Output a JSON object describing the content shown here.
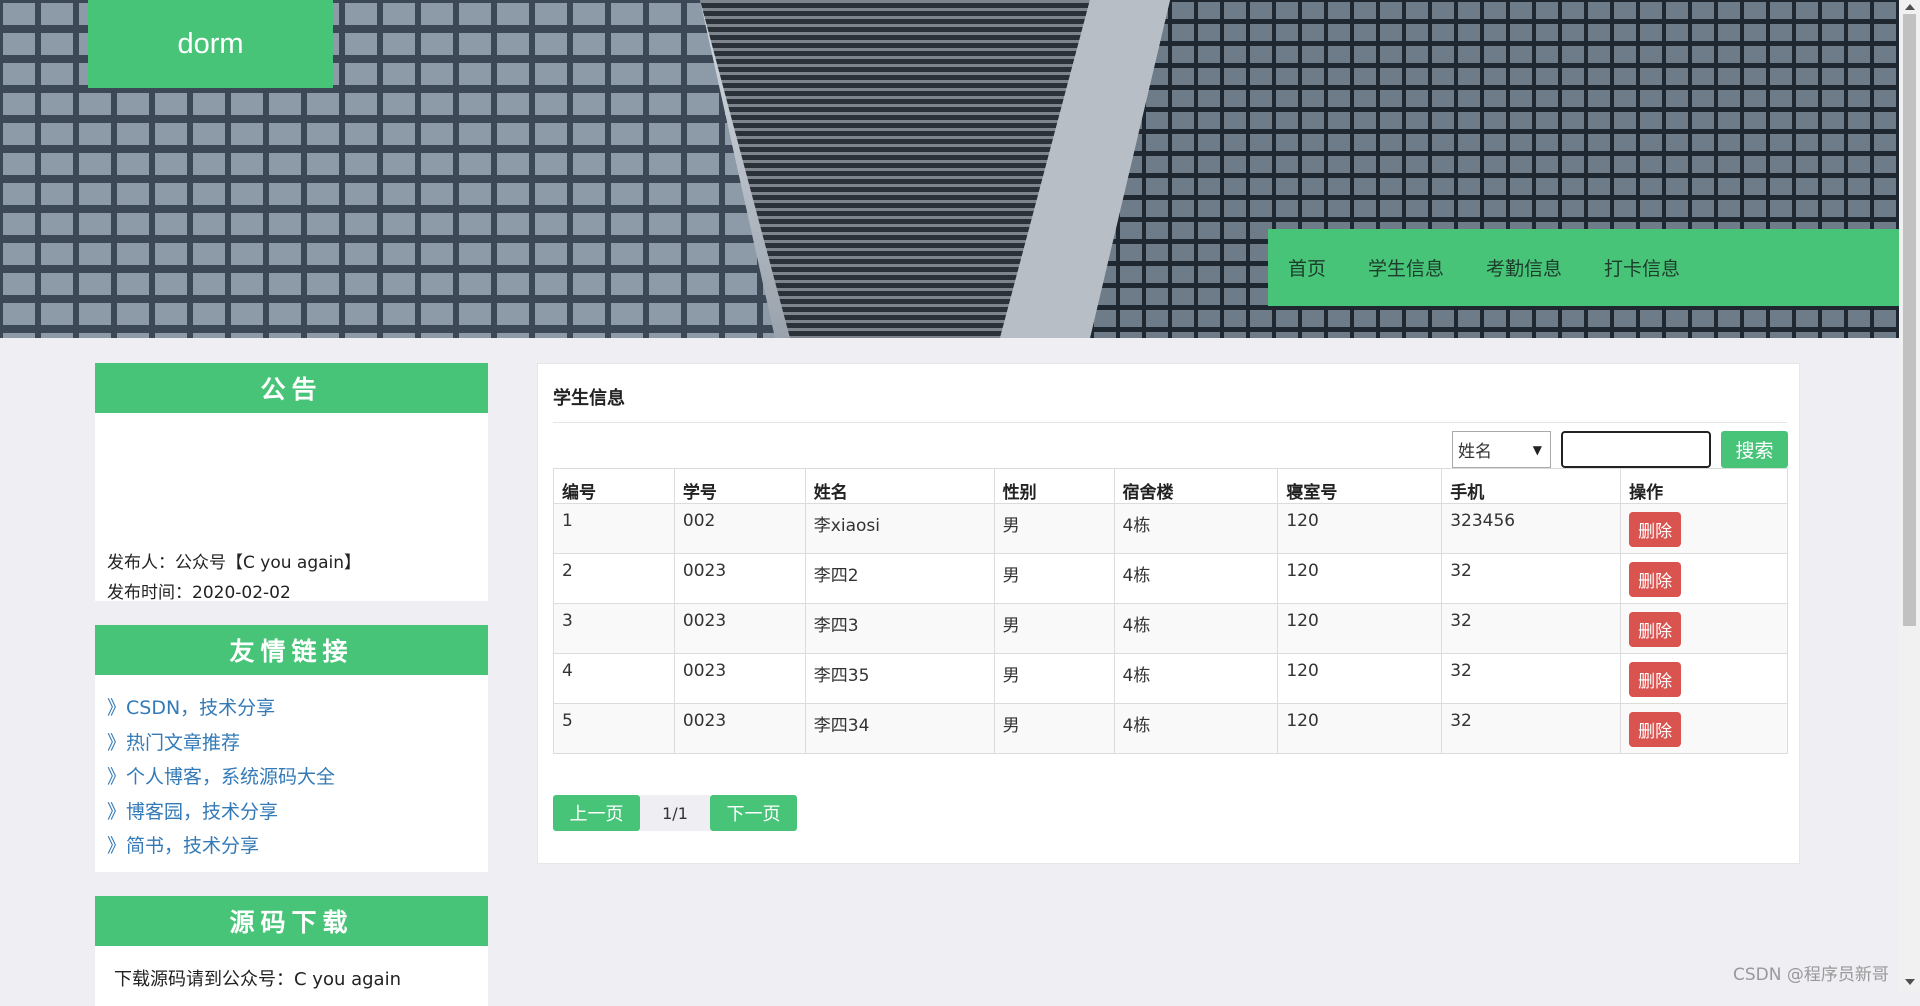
{
  "header": {
    "logo": "dorm",
    "nav": [
      "首页",
      "学生信息",
      "考勤信息",
      "打卡信息"
    ]
  },
  "notice": {
    "title": "公告",
    "publisher": "发布人：公众号【C you again】",
    "time": "发布时间：2020-02-02"
  },
  "links": {
    "title": "友情链接",
    "items": [
      "》CSDN，技术分享",
      "》热门文章推荐",
      "》个人博客，系统源码大全",
      "》博客园，技术分享",
      "》简书，技术分享"
    ]
  },
  "download": {
    "title": "源码下载",
    "text": "下载源码请到公众号：C you again"
  },
  "main": {
    "title": "学生信息",
    "search": {
      "select_value": "姓名",
      "input_value": "",
      "button": "搜索"
    },
    "table": {
      "headers": [
        "编号",
        "学号",
        "姓名",
        "性别",
        "宿舍楼",
        "寝室号",
        "手机",
        "操作"
      ],
      "rows": [
        [
          "1",
          "002",
          "李xiaosi",
          "男",
          "4栋",
          "120",
          "323456"
        ],
        [
          "2",
          "0023",
          "李四2",
          "男",
          "4栋",
          "120",
          "32"
        ],
        [
          "3",
          "0023",
          "李四3",
          "男",
          "4栋",
          "120",
          "32"
        ],
        [
          "4",
          "0023",
          "李四35",
          "男",
          "4栋",
          "120",
          "32"
        ],
        [
          "5",
          "0023",
          "李四34",
          "男",
          "4栋",
          "120",
          "32"
        ]
      ],
      "delete_label": "删除"
    },
    "pager": {
      "prev": "上一页",
      "page": "1/1",
      "next": "下一页"
    }
  },
  "watermark": "CSDN @程序员新哥",
  "colors": {
    "accent": "#48c479",
    "danger": "#d9534f",
    "link": "#337ab7"
  }
}
